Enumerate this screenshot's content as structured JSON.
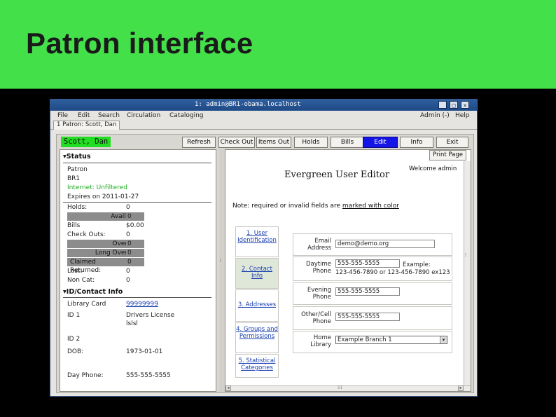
{
  "slide": {
    "title": "Patron interface"
  },
  "window": {
    "title": "1: admin@BR1-obama.localhost",
    "btn_min": "_",
    "btn_max": "□",
    "btn_close": "×"
  },
  "menubar": {
    "file": "File",
    "edit": "Edit",
    "search": "Search",
    "circulation": "Circulation",
    "cataloging": "Cataloging",
    "admin": "Admin (-)",
    "help": "Help"
  },
  "tab": {
    "label": "1 Patron: Scott, Dan"
  },
  "toolbar": {
    "patron_name": "Scott, Dan",
    "refresh": "Refresh",
    "check_out": "Check Out",
    "items_out": "Items Out",
    "holds": "Holds",
    "bills": "Bills",
    "edit": "Edit",
    "info": "Info",
    "exit": "Exit"
  },
  "status": {
    "heading": "Status",
    "patron": "Patron",
    "library": "BR1",
    "internet": "Internet: Unfiltered",
    "expires": "Expires on 2011-01-27",
    "holds_label": "Holds:",
    "holds_value": "0",
    "available_label": "Available:",
    "available_value": "0",
    "bills_label": "Bills",
    "bills_value": "$0.00",
    "checkouts_label": "Check Outs:",
    "checkouts_value": "0",
    "overdue_label": "Overdue:",
    "overdue_value": "0",
    "long_overdue_label": "Long Overdue:",
    "long_overdue_value": "0",
    "claimed_label": "Claimed Returned:",
    "claimed_value": "0",
    "lost_label": "Lost:",
    "lost_value": "0",
    "noncat_label": "Non Cat:",
    "noncat_value": "0"
  },
  "id_contact": {
    "heading": "ID/Contact Info",
    "library_card_label": "Library Card",
    "library_card_value": "99999999",
    "id1_label": "ID 1",
    "id1_value": "Drivers License",
    "id1_value2": "lslsl",
    "id2_label": "ID 2",
    "dob_label": "DOB:",
    "dob_value": "1973-01-01",
    "day_phone_label": "Day Phone:",
    "day_phone_value": "555-555-5555"
  },
  "editor": {
    "print_page": "Print Page",
    "title": "Evergreen User Editor",
    "welcome": "Welcome admin",
    "note_pre": "Note: required or invalid fields are ",
    "note_marked": "marked with color",
    "nav": {
      "user_id": "1. User Identification",
      "contact_info": "2. Contact Info",
      "addresses": "3. Addresses",
      "groups": "4. Groups and Permissions",
      "statistical": "5. Statistical Categories"
    },
    "fields": {
      "email_label": "Email Address",
      "email_value": "demo@demo.org",
      "daytime_label": "Daytime Phone",
      "daytime_value": "555-555-5555",
      "daytime_hint1": "Example:",
      "daytime_hint2": "123-456-7890 or 123-456-7890 ex123",
      "evening_label": "Evening Phone",
      "evening_value": "555-555-5555",
      "other_label": "Other/Cell Phone",
      "other_value": "555-555-5555",
      "home_label": "Home Library",
      "home_value": "Example Branch 1"
    }
  }
}
